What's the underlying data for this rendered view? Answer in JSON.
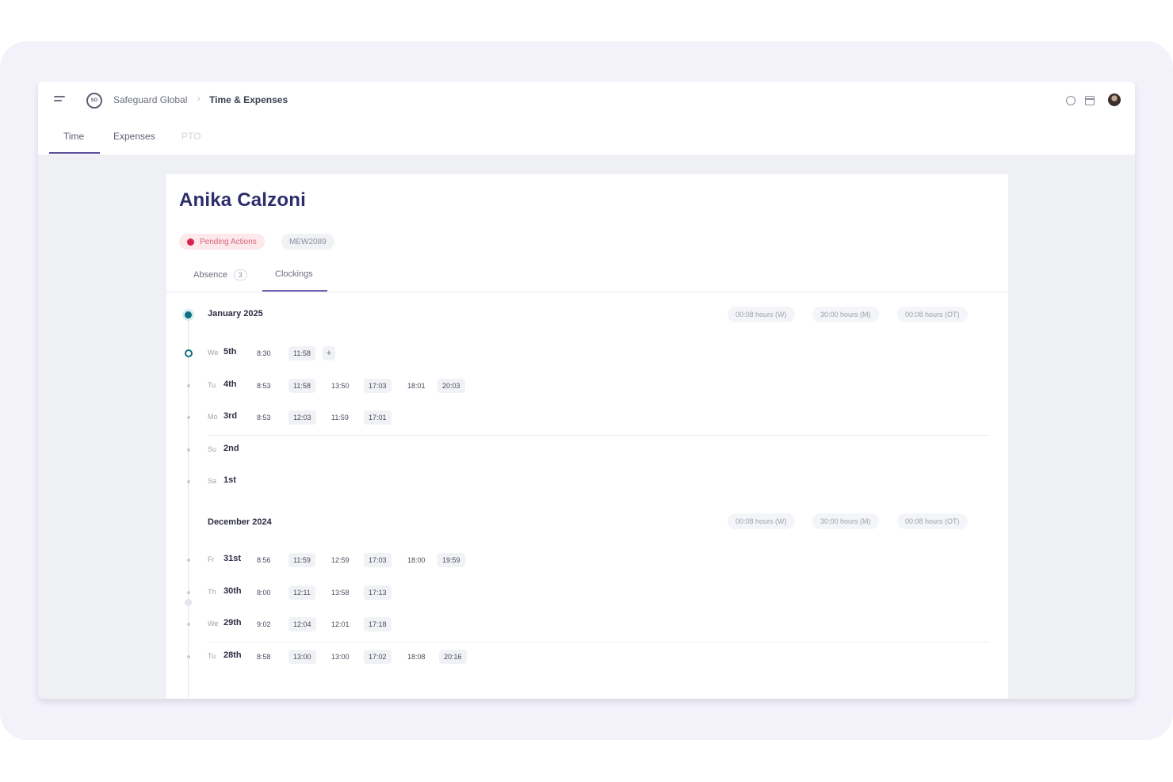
{
  "header": {
    "organization": "Safeguard Global",
    "separator": "›",
    "page": "Time & Expenses",
    "logo_text": "SG"
  },
  "nav_tabs": [
    {
      "label": "Time"
    },
    {
      "label": "Expenses"
    },
    {
      "label": "PTO"
    }
  ],
  "employee": {
    "name": "Anika Calzoni",
    "status_badge": "Pending Actions",
    "employee_id": "MEW2089"
  },
  "sub_tabs": [
    {
      "label": "Absence",
      "count": "3"
    },
    {
      "label": "Clockings"
    }
  ],
  "months": [
    {
      "label": "January 2025",
      "totals": [
        "00:08 hours (W)",
        "30:00 hours (M)",
        "00:08 hours (OT)"
      ],
      "days": [
        {
          "weekday": "We",
          "day": "5th",
          "times": [
            "8:30",
            "11:58"
          ],
          "today": true
        },
        {
          "weekday": "Tu",
          "day": "4th",
          "times": [
            "8:53",
            "11:58",
            "13:50",
            "17:03",
            "18:01",
            "20:03"
          ]
        },
        {
          "weekday": "Mo",
          "day": "3rd",
          "times": [
            "8:53",
            "12:03",
            "11:59",
            "17:01"
          ]
        },
        {
          "weekday": "Su",
          "day": "2nd",
          "times": []
        },
        {
          "weekday": "Sa",
          "day": "1st",
          "times": []
        }
      ]
    },
    {
      "label": "December 2024",
      "totals": [
        "00:08 hours (W)",
        "30:00 hours (M)",
        "00:08 hours (OT)"
      ],
      "days": [
        {
          "weekday": "Fr",
          "day": "31st",
          "times": [
            "8:56",
            "11:59",
            "12:59",
            "17:03",
            "18:00",
            "19:59"
          ]
        },
        {
          "weekday": "Th",
          "day": "30th",
          "times": [
            "8:00",
            "12:11",
            "13:58",
            "17:13"
          ]
        },
        {
          "weekday": "We",
          "day": "29th",
          "times": [
            "9:02",
            "12:04",
            "12:01",
            "17:18"
          ]
        },
        {
          "weekday": "Tu",
          "day": "28th",
          "times": [
            "8:58",
            "13:00",
            "13:00",
            "17:02",
            "18:08",
            "20:16"
          ]
        }
      ]
    }
  ],
  "add_label": "+",
  "colors": {
    "accent": "#2e2d6b",
    "tab_underline": "#5a4d9a",
    "active_dot": "#0d7182",
    "pending_dot": "#d9224d"
  },
  "icons": [
    "menu-icon",
    "logo-icon",
    "help-icon",
    "calendar-icon",
    "avatar"
  ]
}
